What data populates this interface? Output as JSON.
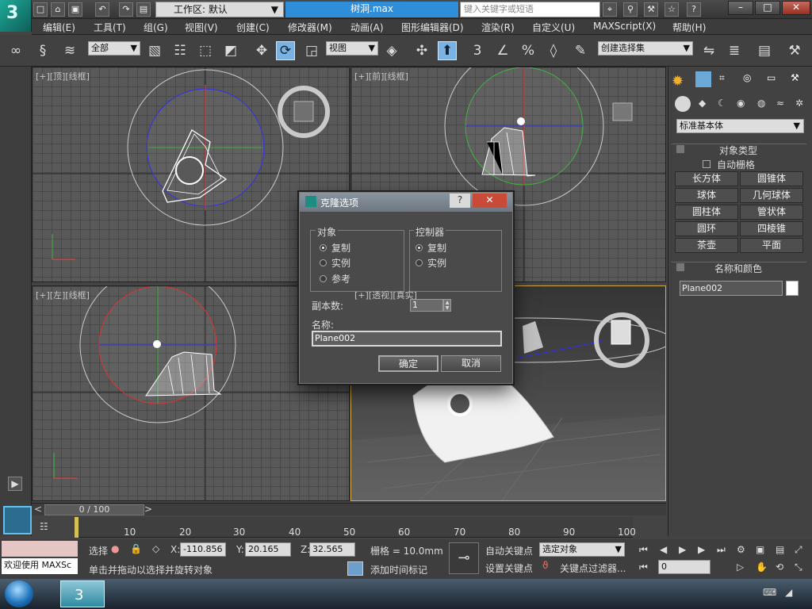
{
  "app": {
    "logo_text": "3",
    "file_name": "树洞.max",
    "workspace": "工作区: 默认",
    "search_placeholder": "键入关键字或短语"
  },
  "menu": [
    "编辑(E)",
    "工具(T)",
    "组(G)",
    "视图(V)",
    "创建(C)",
    "修改器(M)",
    "动画(A)",
    "图形编辑器(D)",
    "渲染(R)",
    "自定义(U)",
    "MAXScript(X)",
    "帮助(H)"
  ],
  "toolbar": {
    "filter": "全部",
    "coordinate_system": "视图",
    "named_selection": "创建选择集",
    "snap_3": "3",
    "angle_snap": "∠",
    "percent_snap": "%",
    "spinner_snap": "◊"
  },
  "viewports": [
    {
      "label": "[+][顶][线框]"
    },
    {
      "label": "[+][前][线框]"
    },
    {
      "label": "[+][左][线框]"
    },
    {
      "label": "[+][透视][真实]"
    }
  ],
  "dialog": {
    "title": "克隆选项",
    "help": "?",
    "close": "✕",
    "object_group": "对象",
    "controller_group": "控制器",
    "object_options": [
      "复制",
      "实例",
      "参考"
    ],
    "controller_options": [
      "复制",
      "实例"
    ],
    "copies_label": "副本数:",
    "copies_value": "1",
    "name_label": "名称:",
    "name_value": "Plane002",
    "ok": "确定",
    "cancel": "取消"
  },
  "panel": {
    "dropdown": "标准基本体",
    "object_type": "对象类型",
    "autogrid": "自动栅格",
    "buttons": [
      "长方体",
      "圆锥体",
      "球体",
      "几何球体",
      "圆柱体",
      "管状体",
      "圆环",
      "四棱锥",
      "茶壶",
      "平面"
    ],
    "name_color": "名称和颜色",
    "object_name": "Plane002",
    "swatch_color": "#ffffff"
  },
  "timeline": {
    "frame": "0 / 100",
    "ticks": [
      "10",
      "20",
      "30",
      "40",
      "50",
      "60",
      "70",
      "80",
      "90",
      "100"
    ]
  },
  "status": {
    "welcome": "欢迎使用 MAXSc",
    "selection": "选择",
    "x_label": "X:",
    "x": "-110.856",
    "y_label": "Y:",
    "y": "20.165",
    "z_label": "Z:",
    "z": "32.565",
    "grid": "栅格 = 10.0mm",
    "auto_key": "自动关键点",
    "set_key": "设置关键点",
    "selected": "选定对象",
    "key_filter": "关键点过滤器...",
    "prompt": "单击并拖动以选择并旋转对象",
    "add_time_tag": "添加时间标记",
    "frame": "0"
  }
}
